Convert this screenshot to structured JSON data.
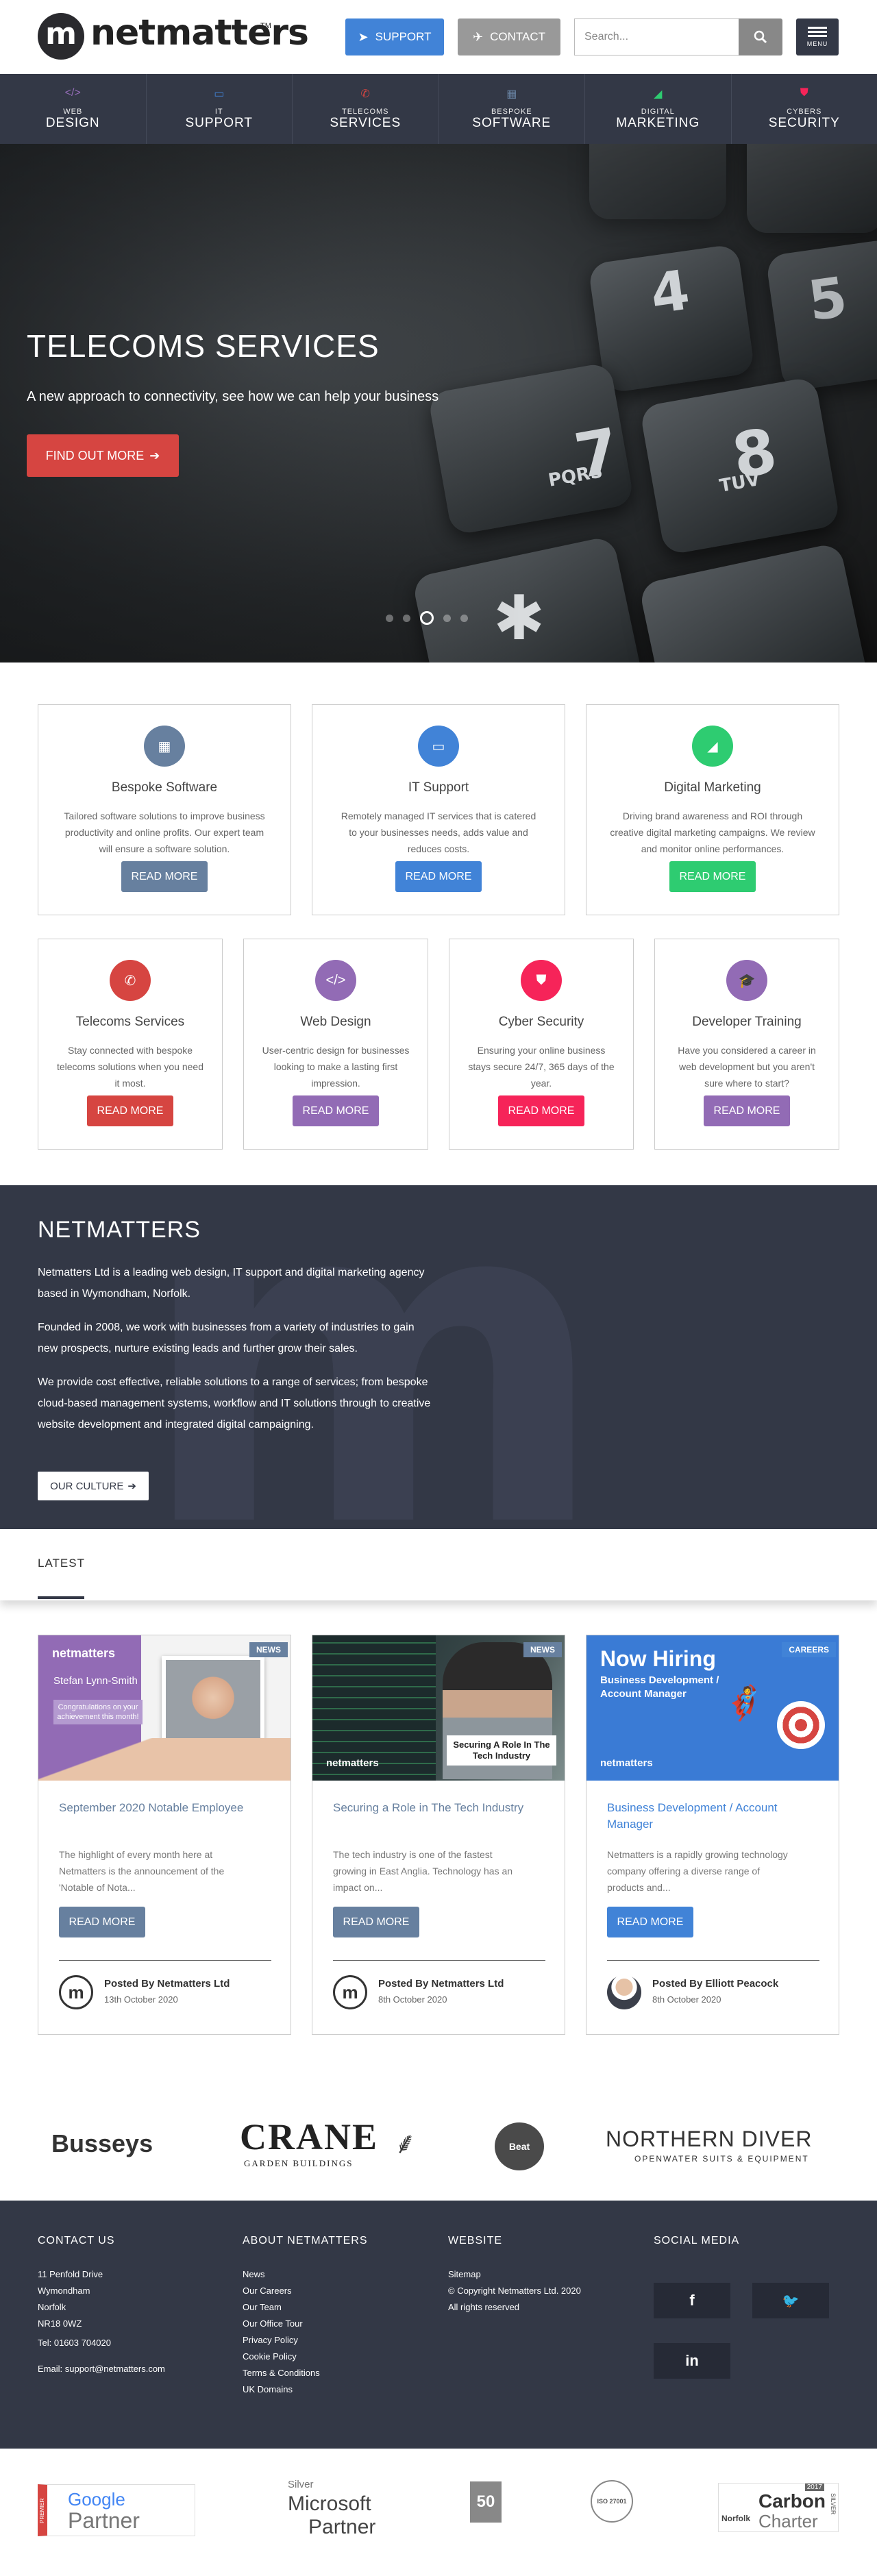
{
  "header": {
    "logo_text": "netmatters",
    "logo_mark": "m",
    "logo_tm": "TM",
    "support_label": "SUPPORT",
    "contact_label": "CONTACT",
    "search_placeholder": "Search...",
    "menu_label": "MENU"
  },
  "nav": [
    {
      "small": "WEB",
      "big": "DESIGN",
      "icon": "code-icon",
      "glyph": "</>",
      "color": "#926bb5"
    },
    {
      "small": "IT",
      "big": "SUPPORT",
      "icon": "monitor-icon",
      "glyph": "▭",
      "color": "#4183d7"
    },
    {
      "small": "TELECOMS",
      "big": "SERVICES",
      "icon": "phone-icon",
      "glyph": "✆",
      "color": "#d64541"
    },
    {
      "small": "BESPOKE",
      "big": "SOFTWARE",
      "icon": "grid-icon",
      "glyph": "▦",
      "color": "#67809f"
    },
    {
      "small": "DIGITAL",
      "big": "MARKETING",
      "icon": "signal-icon",
      "glyph": "◢",
      "color": "#2ecc71"
    },
    {
      "small": "CYBERS",
      "big": "SECURITY",
      "icon": "shield-icon",
      "glyph": "⛊",
      "color": "#f62459"
    }
  ],
  "hero": {
    "title": "TELECOMS SERVICES",
    "subtitle": "A new approach to connectivity, see how we can help your business",
    "button": "FIND OUT MORE",
    "slides": 5,
    "active_slide": 3
  },
  "services": [
    {
      "title": "Bespoke Software",
      "desc": "Tailored software solutions to improve business productivity and online profits. Our expert team will ensure a software solution.",
      "button": "READ MORE",
      "color": "#67809f",
      "icon": "grid-icon",
      "glyph": "▦"
    },
    {
      "title": "IT Support",
      "desc": "Remotely managed IT services that is catered to your businesses needs, adds value and reduces costs.",
      "button": "READ MORE",
      "color": "#4183d7",
      "icon": "monitor-icon",
      "glyph": "▭"
    },
    {
      "title": "Digital Marketing",
      "desc": "Driving brand awareness and ROI through creative digital marketing campaigns. We review and monitor online performances.",
      "button": "READ MORE",
      "color": "#2ecc71",
      "icon": "signal-icon",
      "glyph": "◢"
    },
    {
      "title": "Telecoms Services",
      "desc": "Stay connected with bespoke telecoms solutions when you need it most.",
      "button": "READ MORE",
      "color": "#d64541",
      "icon": "phone-icon",
      "glyph": "✆"
    },
    {
      "title": "Web Design",
      "desc": "User-centric design for businesses looking to make a lasting first impression.",
      "button": "READ MORE",
      "color": "#926bb5",
      "icon": "code-icon",
      "glyph": "</>"
    },
    {
      "title": "Cyber Security",
      "desc": "Ensuring your online business stays secure 24/7, 365 days of the year.",
      "button": "READ MORE",
      "color": "#f62459",
      "icon": "shield-icon",
      "glyph": "⛊"
    },
    {
      "title": "Developer Training",
      "desc": "Have you considered a career in web development but you aren't sure where to start?",
      "button": "READ MORE",
      "color": "#926bb5",
      "icon": "graduation-cap-icon",
      "glyph": "🎓"
    }
  ],
  "about": {
    "title": "NETMATTERS",
    "p1": "Netmatters Ltd is a leading web design, IT support and digital marketing agency based in Wymondham, Norfolk.",
    "p2": "Founded in 2008, we work with businesses from a variety of industries to gain new prospects, nurture existing leads and further grow their sales.",
    "p3": "We provide cost effective, reliable solutions to a range of services; from bespoke cloud-based management systems, workflow and IT solutions through to creative website development and integrated digital campaigning.",
    "button": "OUR CULTURE",
    "bg_letter": "m"
  },
  "latest": {
    "label": "LATEST",
    "news": [
      {
        "tag": "NEWS",
        "tag_color": "#67809f",
        "title": "September 2020 Notable Employee",
        "title_color": "#67809f",
        "excerpt": "The highlight of every month here at Netmatters is the announcement of the 'Notable of Nota...",
        "button": "READ MORE",
        "btn_color": "#67809f",
        "author": "Posted By Netmatters Ltd",
        "date": "13th October 2020",
        "img_logo": "netmatters",
        "img_name": "Stefan Lynn-Smith",
        "img_caption": "Congratulations on your achievement this month!"
      },
      {
        "tag": "NEWS",
        "tag_color": "#67809f",
        "title": "Securing a Role in The Tech Industry",
        "title_color": "#67809f",
        "excerpt": "The tech industry is one of the fastest growing in East Anglia. Technology has an impact on...",
        "button": "READ MORE",
        "btn_color": "#67809f",
        "author": "Posted By Netmatters Ltd",
        "date": "8th October 2020",
        "img_logo": "netmatters",
        "img_caption": "Securing A Role In The Tech Industry"
      },
      {
        "tag": "CAREERS",
        "tag_color": "#4183d7",
        "title": "Business Development / Account Manager",
        "title_color": "#4183d7",
        "excerpt": "Netmatters is a rapidly growing technology company offering a diverse range of products and...",
        "button": "READ MORE",
        "btn_color": "#4183d7",
        "author": "Posted By Elliott Peacock",
        "date": "8th October 2020",
        "img_logo": "netmatters",
        "img_title": "Now Hiring",
        "img_caption": "Business Development / Account Manager"
      }
    ]
  },
  "clients": [
    {
      "name": "Busseys"
    },
    {
      "name": "CRANE",
      "sub": "GARDEN BUILDINGS"
    },
    {
      "name": "Beat"
    },
    {
      "name": "NORTHERN DIVER",
      "sub": "OPENWATER SUITS & EQUIPMENT"
    }
  ],
  "footer": {
    "contact_head": "CONTACT US",
    "address": [
      "11 Penfold Drive",
      "Wymondham",
      "Norfolk",
      "NR18 0WZ"
    ],
    "tel": "Tel: 01603 704020",
    "email": "Email: support@netmatters.com",
    "about_head": "ABOUT NETMATTERS",
    "about_links": [
      "News",
      "Our Careers",
      "Our Team",
      "Our Office Tour",
      "Privacy Policy",
      "Cookie Policy",
      "Terms & Conditions",
      "UK Domains"
    ],
    "website_head": "WEBSITE",
    "website_links": [
      "Sitemap",
      "© Copyright Netmatters Ltd. 2020",
      "All rights reserved"
    ],
    "social_head": "SOCIAL MEDIA",
    "social": [
      {
        "name": "facebook-icon",
        "glyph": "f"
      },
      {
        "name": "twitter-icon",
        "glyph": "🐦"
      },
      {
        "name": "linkedin-icon",
        "glyph": "in"
      }
    ]
  },
  "partners": {
    "google_premier": "PREMIER",
    "google": "Google",
    "google_partner": "Partner",
    "ms_silver": "Silver",
    "ms_name": "Microsoft",
    "ms_partner": "Partner",
    "fifty": "50",
    "iso": "ISO 27001",
    "carbon_top": "2017",
    "carbon_norfolk": "Norfolk",
    "carbon_main": "Carbon",
    "carbon_sub": "Charter",
    "carbon_side": "SILVER"
  }
}
